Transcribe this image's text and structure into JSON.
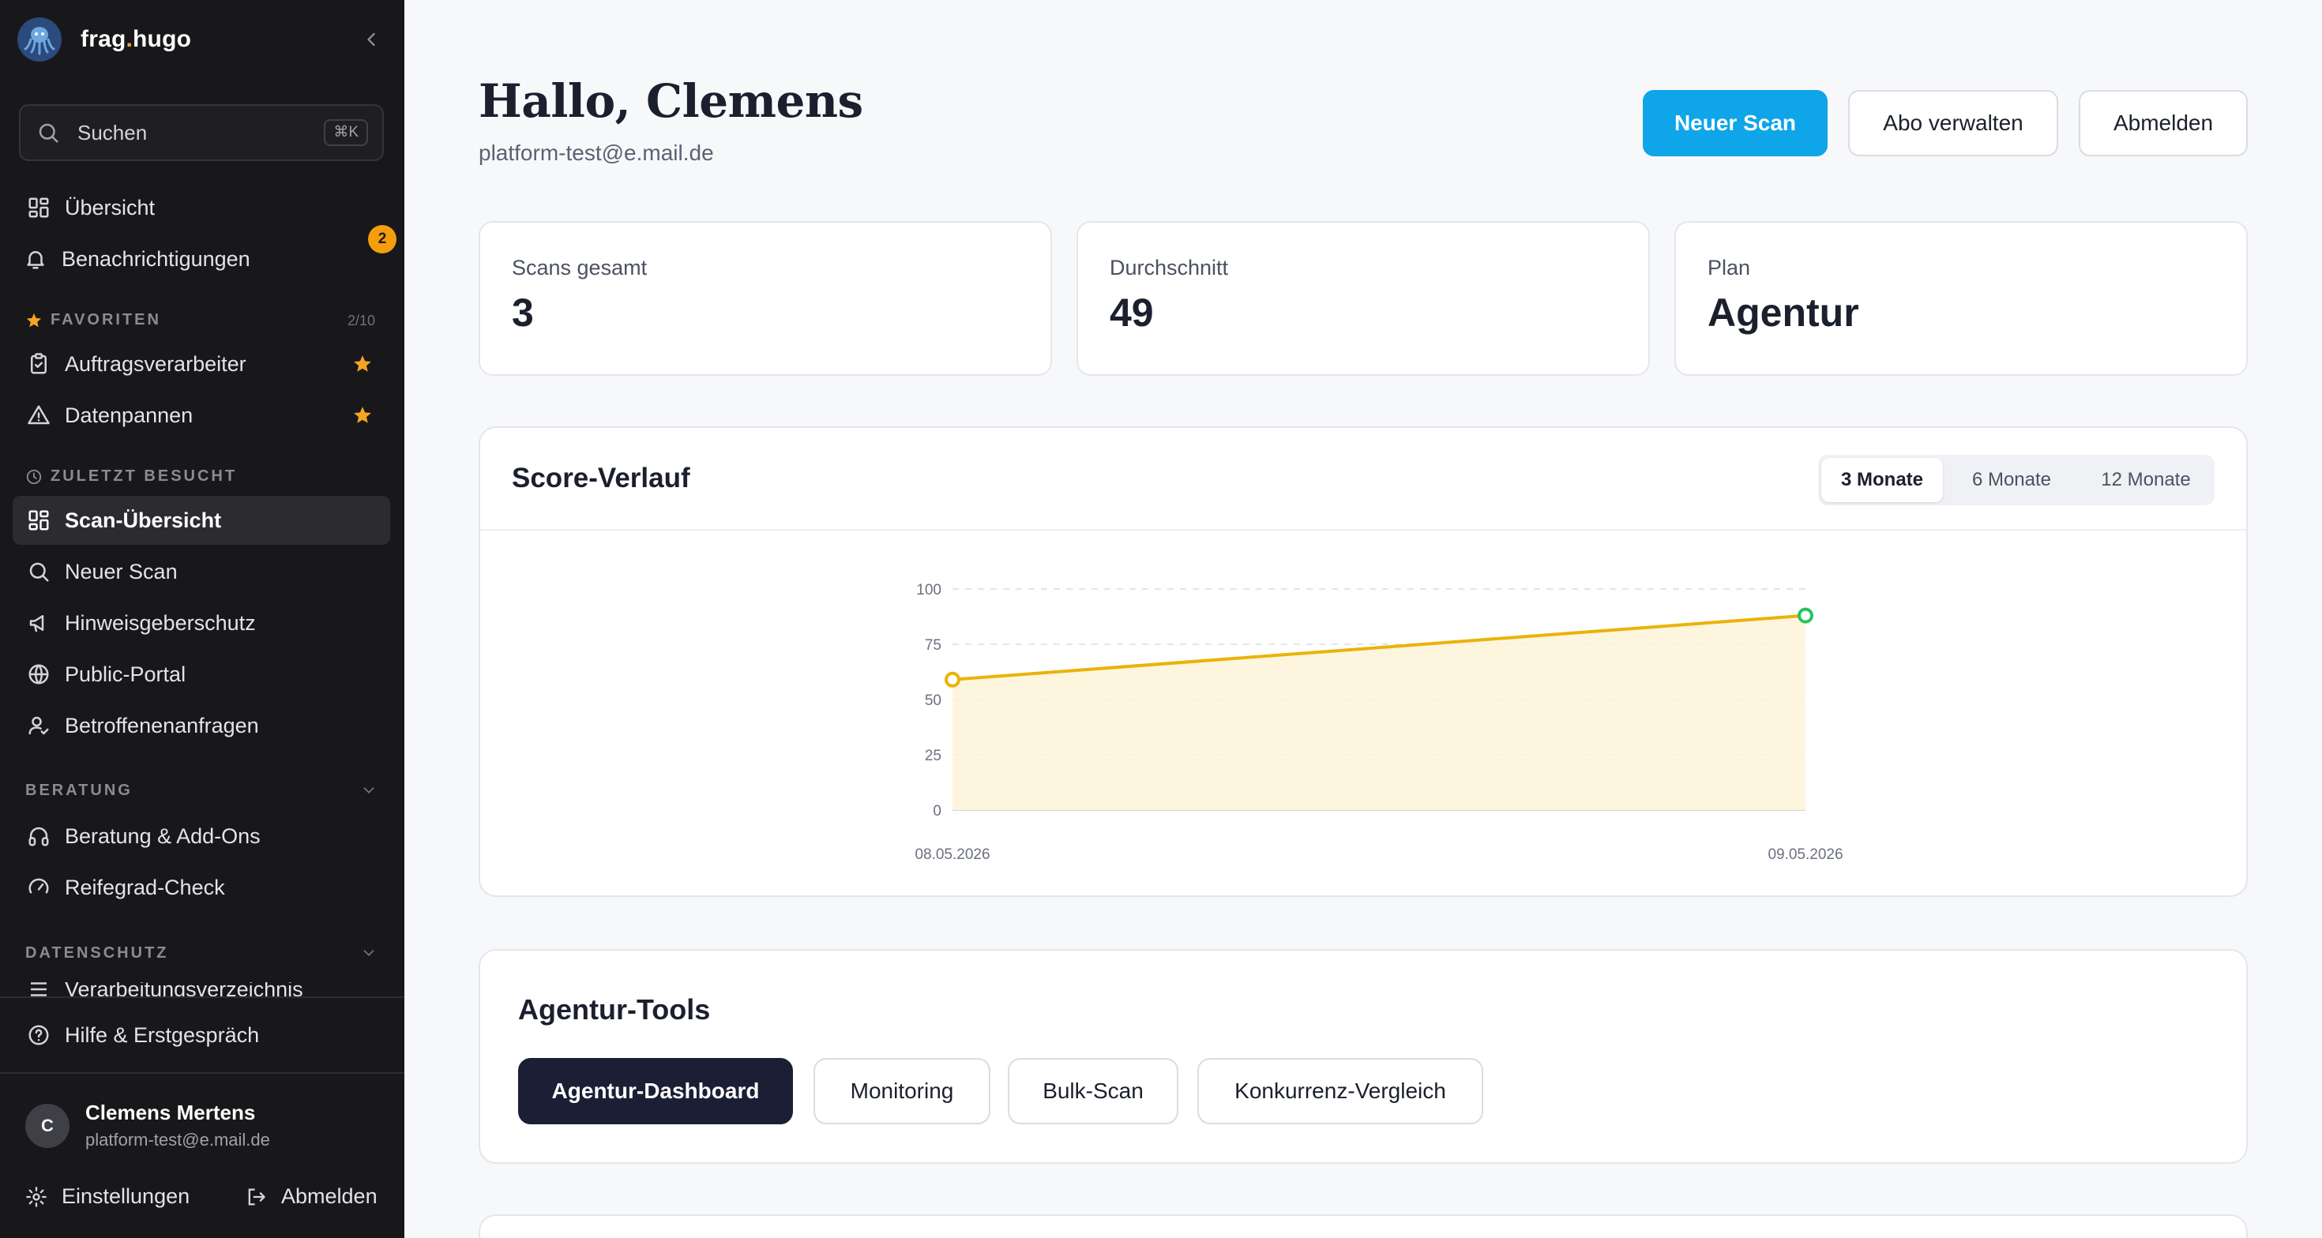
{
  "sidebar": {
    "brand": {
      "prefix": "frag",
      "dot": ".",
      "suffix": "hugo"
    },
    "search": {
      "label": "Suchen",
      "shortcut": "⌘K"
    },
    "nav_top": [
      {
        "label": "Übersicht",
        "icon": "grid-icon"
      },
      {
        "label": "Benachrichtigungen",
        "icon": "bell-icon",
        "badge": "2"
      }
    ],
    "favorites": {
      "title": "FAVORITEN",
      "count": "2/10",
      "items": [
        {
          "label": "Auftragsverarbeiter",
          "icon": "clipboard-check-icon"
        },
        {
          "label": "Datenpannen",
          "icon": "warning-triangle-icon"
        }
      ]
    },
    "recent": {
      "title": "ZULETZT BESUCHT",
      "items": [
        {
          "label": "Scan-Übersicht",
          "icon": "grid-icon",
          "active": true
        },
        {
          "label": "Neuer Scan",
          "icon": "search-icon"
        },
        {
          "label": "Hinweisgeberschutz",
          "icon": "megaphone-icon"
        },
        {
          "label": "Public-Portal",
          "icon": "globe-icon"
        },
        {
          "label": "Betroffenenanfragen",
          "icon": "user-check-icon"
        }
      ]
    },
    "beratung": {
      "title": "BERATUNG",
      "items": [
        {
          "label": "Beratung & Add-Ons",
          "icon": "headphones-icon"
        },
        {
          "label": "Reifegrad-Check",
          "icon": "gauge-icon"
        }
      ]
    },
    "datenschutz": {
      "title": "DATENSCHUTZ",
      "cut_item": "Verarbeitungsverzeichnis"
    },
    "help": "Hilfe & Erstgespräch",
    "user": {
      "initial": "C",
      "name": "Clemens Mertens",
      "email": "platform-test@e.mail.de"
    },
    "settings": "Einstellungen",
    "logout": "Abmelden"
  },
  "header": {
    "greeting": "Hallo, Clemens",
    "email": "platform-test@e.mail.de",
    "buttons": {
      "new_scan": "Neuer Scan",
      "manage": "Abo verwalten",
      "logout": "Abmelden"
    }
  },
  "stats": [
    {
      "label": "Scans gesamt",
      "value": "3"
    },
    {
      "label": "Durchschnitt",
      "value": "49"
    },
    {
      "label": "Plan",
      "value": "Agentur"
    }
  ],
  "score_card": {
    "title": "Score-Verlauf",
    "ranges": [
      "3 Monate",
      "6 Monate",
      "12 Monate"
    ],
    "active_range": "3 Monate"
  },
  "chart_data": {
    "type": "area",
    "title": "",
    "xlabel": "",
    "ylabel": "",
    "x": [
      "08.05.2026",
      "09.05.2026"
    ],
    "series": [
      {
        "values": [
          59,
          88
        ]
      }
    ],
    "ylim": [
      0,
      100
    ],
    "yticks": [
      0,
      25,
      50,
      75,
      100
    ],
    "grid": true,
    "colors": {
      "line": "#eab308",
      "fill": "#fdf3d8",
      "last_point": "#22c55e"
    }
  },
  "tools": {
    "title": "Agentur-Tools",
    "items": [
      "Agentur-Dashboard",
      "Monitoring",
      "Bulk-Scan",
      "Konkurrenz-Vergleich"
    ],
    "active": "Agentur-Dashboard"
  },
  "colors": {
    "accent": "#0ea5e9",
    "sidebar_bg": "#18181b",
    "badge": "#f59e0b",
    "star": "#f5a524",
    "dark_button": "#1a1f36"
  }
}
